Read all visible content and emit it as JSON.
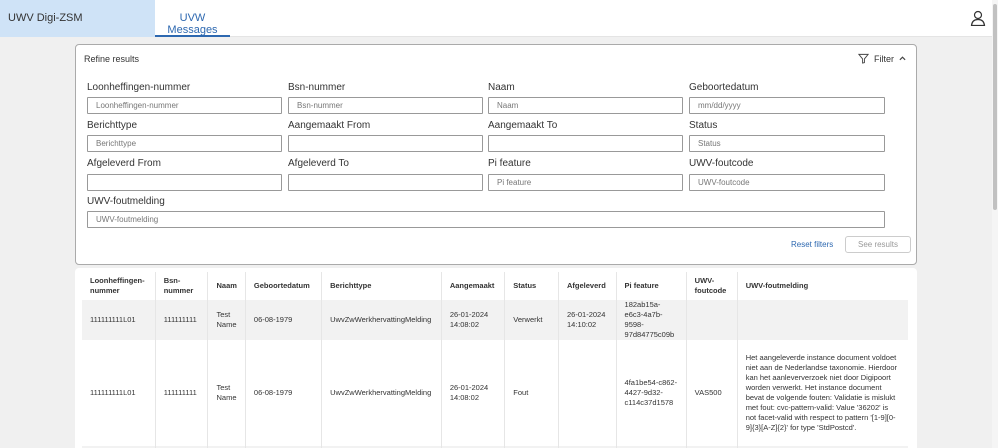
{
  "header": {
    "app_title": "UWV Digi-ZSM",
    "active_tab": "UVW Messages"
  },
  "refine": {
    "title": "Refine results",
    "filter_label": "Filter",
    "fields": [
      {
        "label": "Loonheffingen-nummer",
        "placeholder": "Loonheffingen-nummer"
      },
      {
        "label": "Bsn-nummer",
        "placeholder": "Bsn-nummer"
      },
      {
        "label": "Naam",
        "placeholder": "Naam"
      },
      {
        "label": "Geboortedatum",
        "placeholder": "mm/dd/yyyy"
      },
      {
        "label": "Berichttype",
        "placeholder": "Berichttype"
      },
      {
        "label": "Aangemaakt From",
        "placeholder": ""
      },
      {
        "label": "Aangemaakt To",
        "placeholder": ""
      },
      {
        "label": "Status",
        "placeholder": "Status"
      },
      {
        "label": "Afgeleverd From",
        "placeholder": ""
      },
      {
        "label": "Afgeleverd To",
        "placeholder": ""
      },
      {
        "label": "Pi feature",
        "placeholder": "Pi feature"
      },
      {
        "label": "UWV-foutcode",
        "placeholder": "UWV-foutcode"
      },
      {
        "label": "UWV-foutmelding",
        "placeholder": "UWV-foutmelding"
      }
    ],
    "reset_label": "Reset filters",
    "see_label": "See results"
  },
  "table": {
    "columns": [
      "Loonheffingen-nummer",
      "Bsn-nummer",
      "Naam",
      "Geboortedatum",
      "Berichttype",
      "Aangemaakt",
      "Status",
      "Afgeleverd",
      "Pi feature",
      "UWV-foutcode",
      "UWV-foutmelding"
    ],
    "rows": [
      [
        "111111111L01",
        "111111111",
        "Test Name",
        "06-08-1979",
        "UwvZwWerkhervattingMelding",
        "26-01-2024 14:08:02",
        "Verwerkt",
        "26-01-2024 14:10:02",
        "182ab15a-e6c3-4a7b-9598-97d84775c09b",
        "",
        ""
      ],
      [
        "111111111L01",
        "111111111",
        "Test Name",
        "06-08-1979",
        "UwvZwWerkhervattingMelding",
        "26-01-2024 14:08:02",
        "Fout",
        "",
        "4fa1be54-c862-4427-9d32-c114c37d1578",
        "VAS500",
        "Het aangeleverde instance document voldoet niet aan de Nederlandse taxonomie. Hierdoor kan het aanleververzoek niet door Digipoort worden verwerkt. Het instance document bevat de volgende fouten: Validatie is mislukt met fout: cvc-pattern-valid: Value '36202' is not facet-valid with respect to pattern '[1-9][0-9]{3}[A-Z]{2}' for type 'StdPostcd'."
      ]
    ]
  }
}
